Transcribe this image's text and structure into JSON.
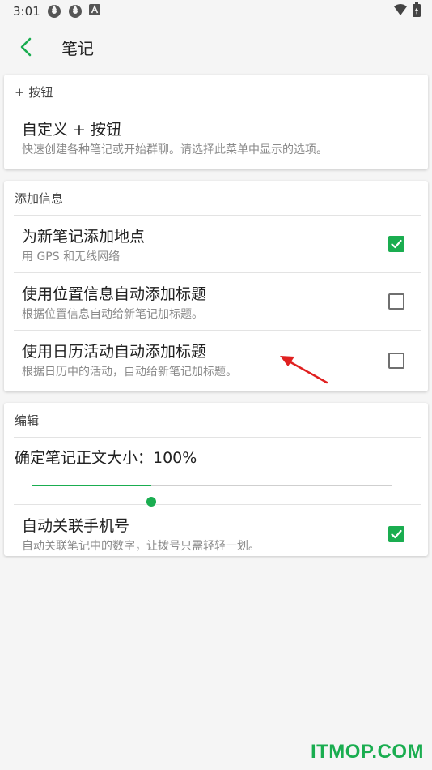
{
  "status_bar": {
    "time": "3:01",
    "left_icons": [
      "sync-icon",
      "sync-icon",
      "a-icon"
    ],
    "right_icons": [
      "wifi-icon",
      "battery-icon"
    ]
  },
  "app_bar": {
    "title": "笔记",
    "back_icon": "back-arrow-icon"
  },
  "sections": {
    "plus_button": {
      "header": "+ 按钮",
      "item": {
        "title": "自定义 + 按钮",
        "subtitle": "快速创建各种笔记或开始群聊。请选择此菜单中显示的选项。"
      }
    },
    "add_info": {
      "header": "添加信息",
      "items": [
        {
          "title": "为新笔记添加地点",
          "subtitle": "用 GPS 和无线网络",
          "checked": true
        },
        {
          "title": "使用位置信息自动添加标题",
          "subtitle": "根据位置信息自动给新笔记加标题。",
          "checked": false
        },
        {
          "title": "使用日历活动自动添加标题",
          "subtitle": "根据日历中的活动，自动给新笔记加标题。",
          "checked": false
        }
      ]
    },
    "edit": {
      "header": "编辑",
      "font_size": {
        "label": "确定笔记正文大小：100%",
        "value_fraction": 0.33
      },
      "auto_link": {
        "title": "自动关联手机号",
        "subtitle": "自动关联笔记中的数字，让拨号只需轻轻一划。",
        "checked": true
      }
    }
  },
  "watermark": "ITMOP.COM",
  "colors": {
    "accent": "#1aad50",
    "annotation_arrow": "#e02020"
  }
}
